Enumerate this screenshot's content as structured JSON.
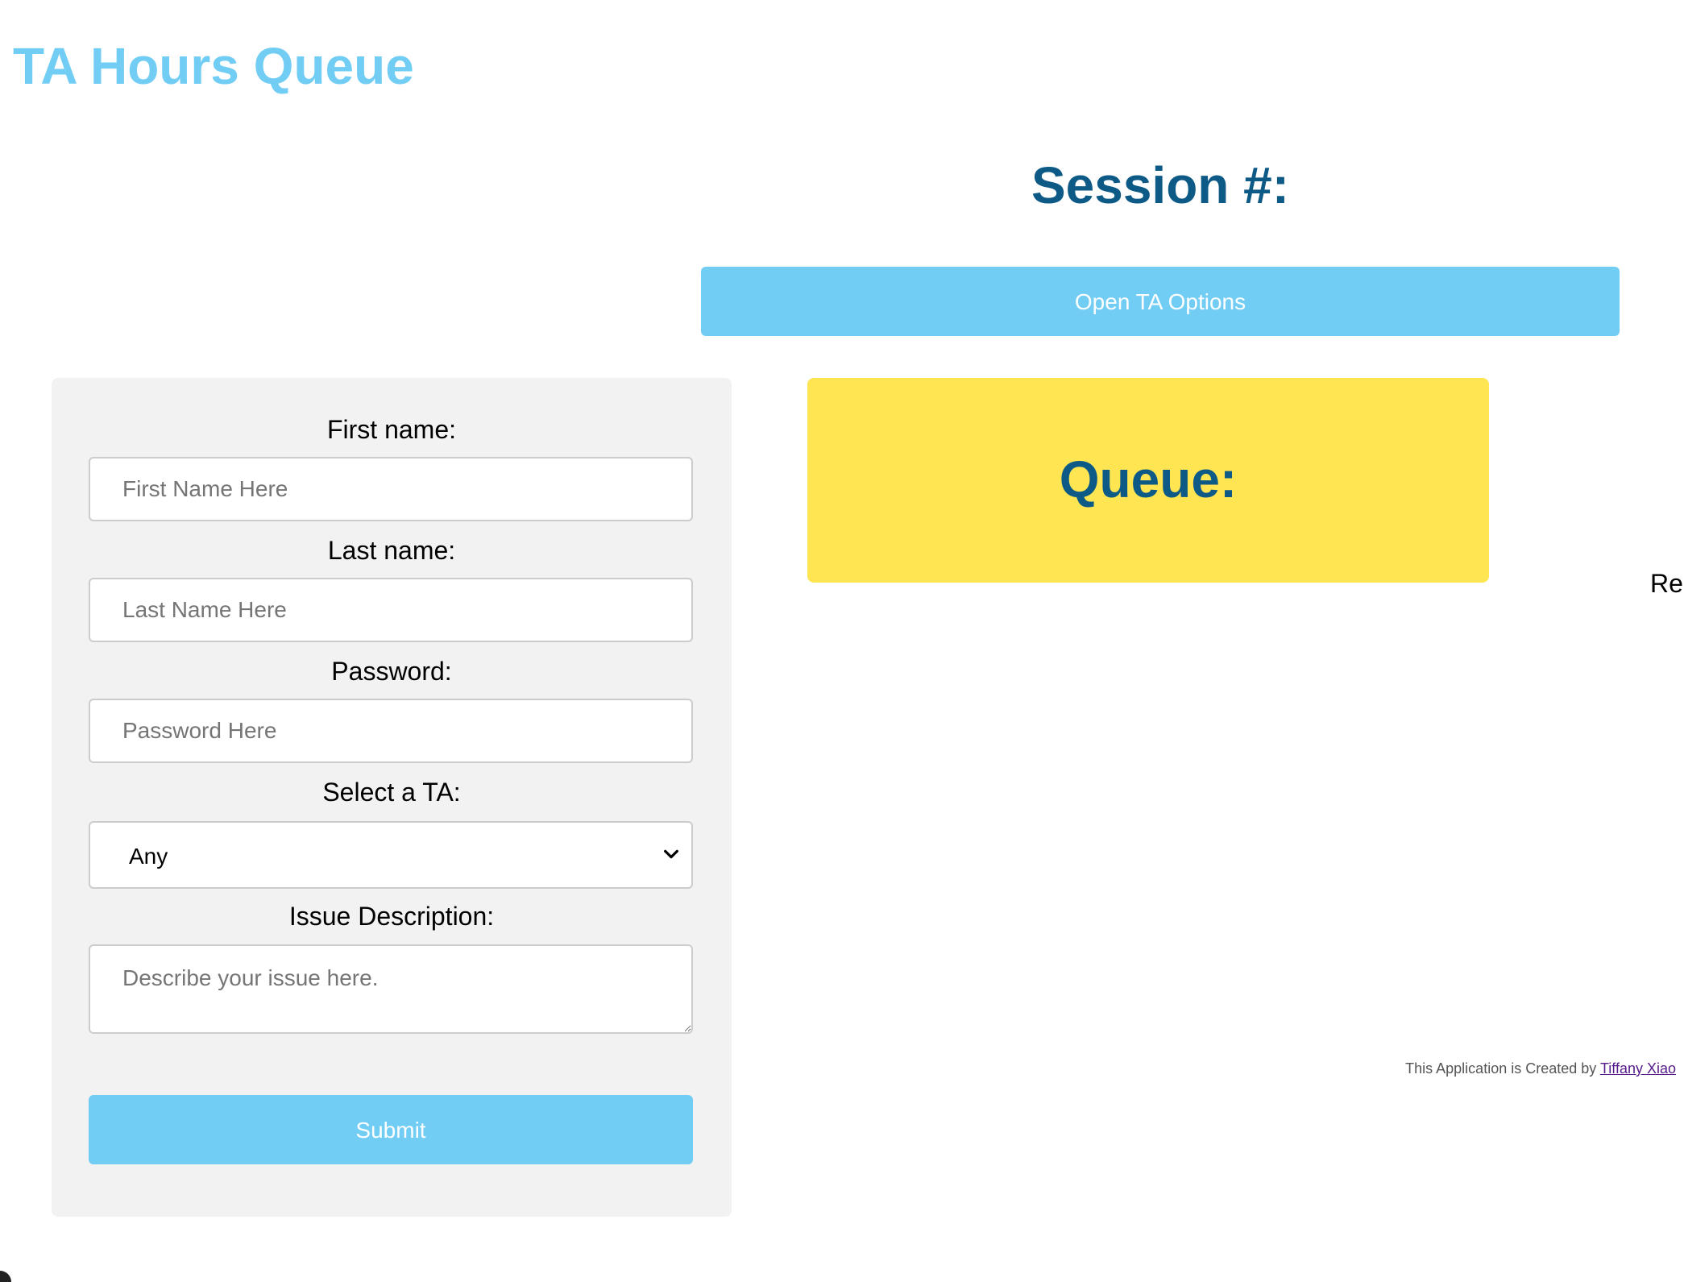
{
  "header": {
    "app_title": "TA Hours Queue"
  },
  "session": {
    "title": "Session #:",
    "ta_options_label": "Open TA Options"
  },
  "form": {
    "first_name_label": "First name:",
    "first_name_placeholder": "First Name Here",
    "last_name_label": "Last name:",
    "last_name_placeholder": "Last Name Here",
    "password_label": "Password:",
    "password_placeholder": "Password Here",
    "ta_label": "Select a TA:",
    "ta_selected": "Any",
    "issue_label": "Issue Description:",
    "issue_placeholder": "Describe your issue here.",
    "submit_label": "Submit"
  },
  "queue": {
    "title": "Queue:"
  },
  "cutoff": {
    "text": "Re"
  },
  "footer": {
    "credit_text": "This Application is Created by ",
    "author_link": "Tiffany Xiao"
  },
  "colors": {
    "accent": "#72cdf4",
    "heading": "#0e5a86",
    "queue_bg": "#ffe552",
    "panel_bg": "#f2f2f2"
  }
}
